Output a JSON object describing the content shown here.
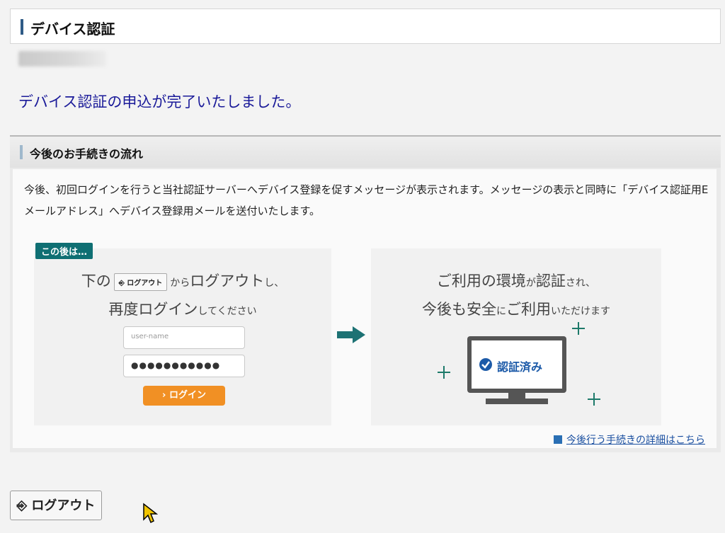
{
  "header": {
    "title": "デバイス認証"
  },
  "complete_message": "デバイス認証の申込が完了いたしました。",
  "flow": {
    "title": "今後のお手続きの流れ",
    "description": "今後、初回ログインを行うと当社認証サーバーへデバイス登録を促すメッセージが表示されます。メッセージの表示と同時に「デバイス認証用Eメールアドレス」へデバイス登録用メールを送付いたします。",
    "after_badge": "この後は…",
    "left": {
      "prefix": "下の",
      "mini_button": "ログアウト",
      "from_text": "から",
      "logout_text": "ログアウト",
      "suffix": "し、",
      "relogin": "再度ログイン",
      "relogin_suffix": "してください",
      "username_placeholder": "user-name",
      "password_mask": "●●●●●●●●●●●",
      "login_button": "ログイン"
    },
    "right": {
      "line1_a": "ご利用の環境",
      "line1_b": "が",
      "line1_c": "認証",
      "line1_d": "され、",
      "line2_a": "今後も安全",
      "line2_b": "に",
      "line2_c": "ご利用",
      "line2_d": "いただけます",
      "verified_label": "認証済み"
    },
    "detail_link": "今後行う手続きの詳細はこちら"
  },
  "footer": {
    "logout_button": "ログアウト"
  },
  "colors": {
    "accent_teal": "#0f6f73",
    "message_blue": "#1a1a99",
    "login_orange": "#f19024",
    "link_blue": "#1a4fa0"
  }
}
